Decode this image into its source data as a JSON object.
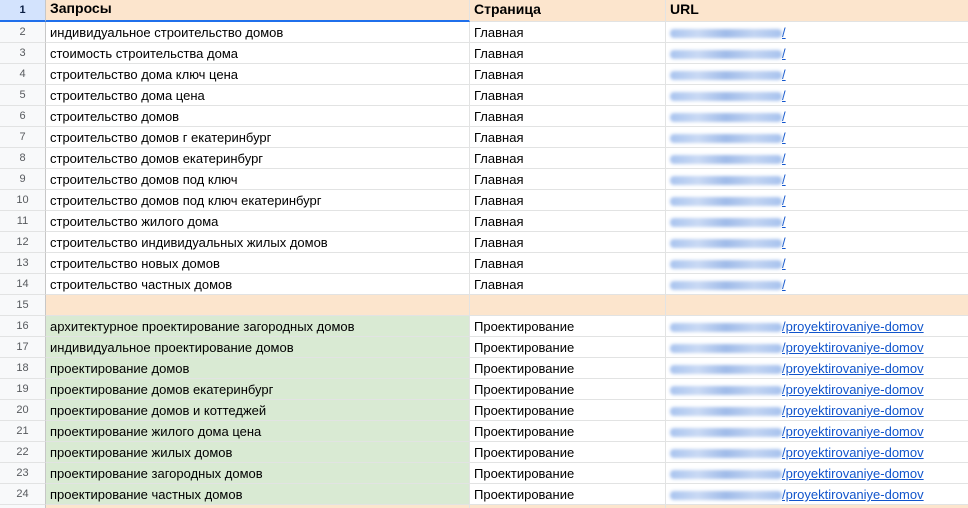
{
  "colors": {
    "header_bg": "#fce5cd",
    "group1_bg": "#ffffff",
    "group2_bg": "#d9ead3",
    "separator_bg": "#fce5cd",
    "selection": "#1f6feb",
    "link": "#1155cc"
  },
  "header": {
    "rownum": "1",
    "col_a": "Запросы",
    "col_b": "Страница",
    "col_c": "URL"
  },
  "rows": [
    {
      "num": "2",
      "query": "индивидуальное строительство домов",
      "page": "Главная",
      "url_path": "/"
    },
    {
      "num": "3",
      "query": "стоимость строительства дома",
      "page": "Главная",
      "url_path": "/"
    },
    {
      "num": "4",
      "query": "строительство дома ключ цена",
      "page": "Главная",
      "url_path": "/"
    },
    {
      "num": "5",
      "query": "строительство дома цена",
      "page": "Главная",
      "url_path": "/"
    },
    {
      "num": "6",
      "query": "строительство домов",
      "page": "Главная",
      "url_path": "/"
    },
    {
      "num": "7",
      "query": "строительство домов г екатеринбург",
      "page": "Главная",
      "url_path": "/"
    },
    {
      "num": "8",
      "query": "строительство домов екатеринбург",
      "page": "Главная",
      "url_path": "/"
    },
    {
      "num": "9",
      "query": "строительство домов под ключ",
      "page": "Главная",
      "url_path": "/"
    },
    {
      "num": "10",
      "query": "строительство домов под ключ екатеринбург",
      "page": "Главная",
      "url_path": "/"
    },
    {
      "num": "11",
      "query": "строительство жилого дома",
      "page": "Главная",
      "url_path": "/"
    },
    {
      "num": "12",
      "query": "строительство индивидуальных жилых домов",
      "page": "Главная",
      "url_path": "/"
    },
    {
      "num": "13",
      "query": "строительство новых домов",
      "page": "Главная",
      "url_path": "/"
    },
    {
      "num": "14",
      "query": "строительство частных домов",
      "page": "Главная",
      "url_path": "/"
    },
    {
      "num": "15",
      "query": "",
      "page": "",
      "url_path": ""
    },
    {
      "num": "16",
      "query": "архитектурное проектирование загородных домов",
      "page": "Проектирование",
      "url_path": "/proyektirovaniye-domov"
    },
    {
      "num": "17",
      "query": "индивидуальное проектирование домов",
      "page": "Проектирование",
      "url_path": "/proyektirovaniye-domov"
    },
    {
      "num": "18",
      "query": "проектирование домов",
      "page": "Проектирование",
      "url_path": "/proyektirovaniye-domov"
    },
    {
      "num": "19",
      "query": "проектирование домов екатеринбург",
      "page": "Проектирование",
      "url_path": "/proyektirovaniye-domov"
    },
    {
      "num": "20",
      "query": "проектирование домов и коттеджей",
      "page": "Проектирование",
      "url_path": "/proyektirovaniye-domov"
    },
    {
      "num": "21",
      "query": "проектирование жилого дома цена",
      "page": "Проектирование",
      "url_path": "/proyektirovaniye-domov"
    },
    {
      "num": "22",
      "query": "проектирование жилых домов",
      "page": "Проектирование",
      "url_path": "/proyektirovaniye-domov"
    },
    {
      "num": "23",
      "query": "проектирование загородных домов",
      "page": "Проектирование",
      "url_path": "/proyektirovaniye-domov"
    },
    {
      "num": "24",
      "query": "проектирование частных домов",
      "page": "Проектирование",
      "url_path": "/proyektirovaniye-domov"
    },
    {
      "num": "",
      "query": "",
      "page": "",
      "url_path": ""
    }
  ]
}
